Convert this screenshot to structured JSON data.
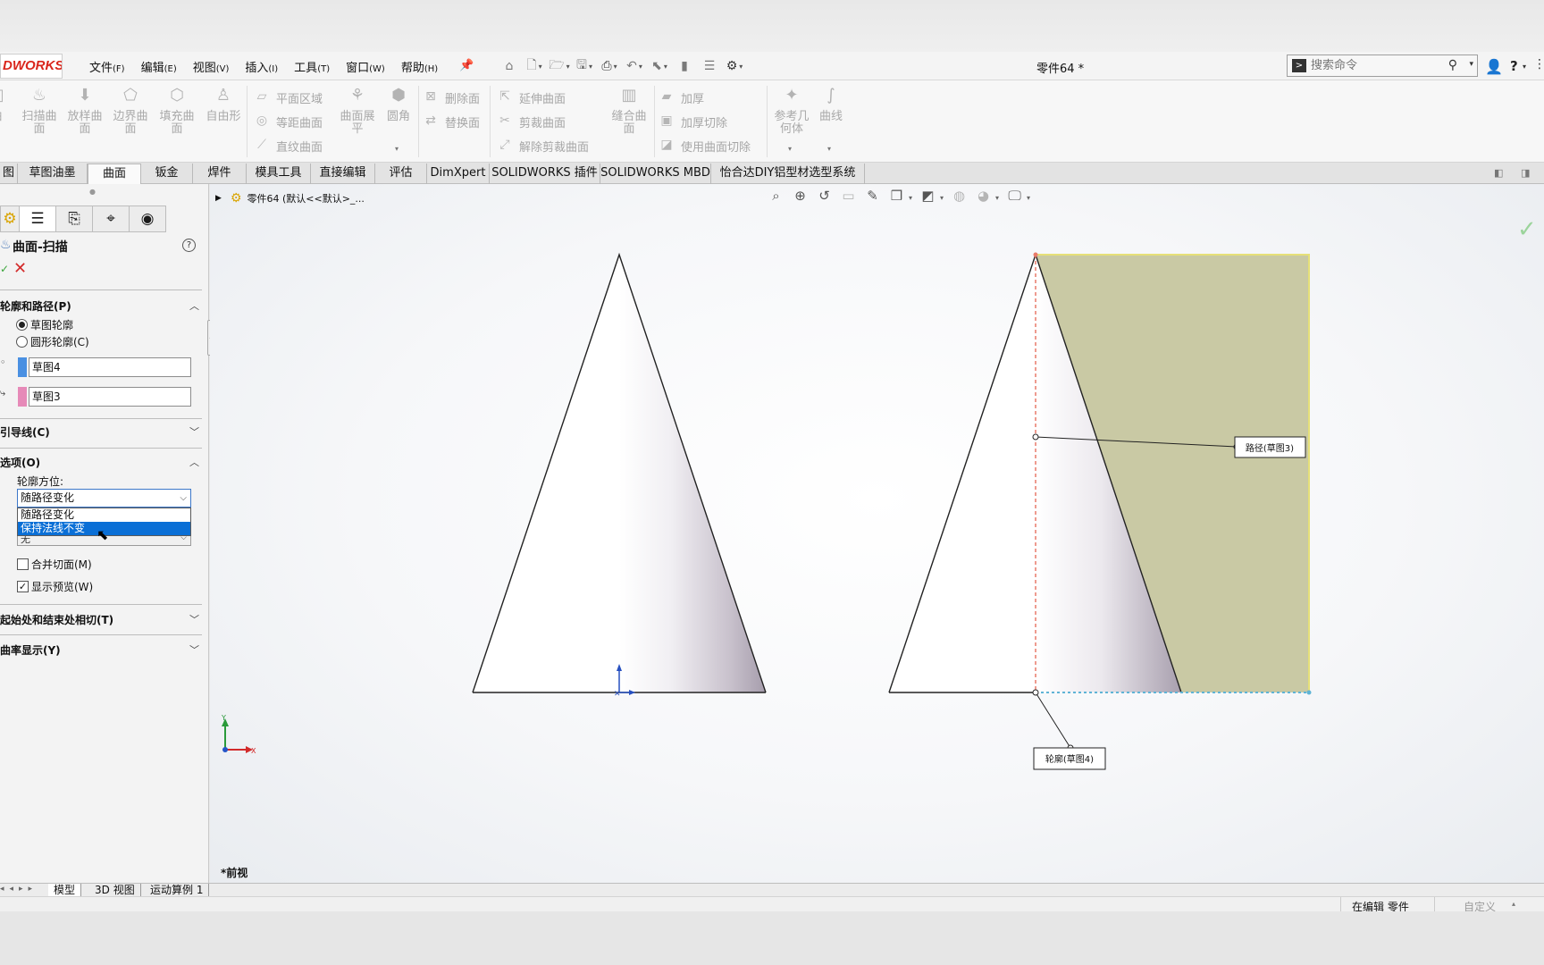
{
  "app": {
    "logo_text": "DWORKS",
    "document_title": "零件64 *"
  },
  "menu": {
    "items": [
      {
        "label": "文件",
        "hotkey": "(F)"
      },
      {
        "label": "编辑",
        "hotkey": "(E)"
      },
      {
        "label": "视图",
        "hotkey": "(V)"
      },
      {
        "label": "插入",
        "hotkey": "(I)"
      },
      {
        "label": "工具",
        "hotkey": "(T)"
      },
      {
        "label": "窗口",
        "hotkey": "(W)"
      },
      {
        "label": "帮助",
        "hotkey": "(H)"
      }
    ]
  },
  "search": {
    "placeholder": "搜索命令"
  },
  "ribbon": {
    "large_buttons": [
      "曲",
      "扫描曲面",
      "放样曲面",
      "边界曲面",
      "填充曲面",
      "自由形",
      "曲面展平",
      "圆角",
      "缝合曲面",
      "参考几何体",
      "曲线"
    ],
    "group1_small": [
      "平面区域",
      "等距曲面",
      "直纹曲面"
    ],
    "group2_small": [
      "删除面",
      "替换面"
    ],
    "group3_small": [
      "延伸曲面",
      "剪裁曲面",
      "解除剪裁曲面"
    ],
    "group4_small": [
      "加厚",
      "加厚切除",
      "使用曲面切除"
    ]
  },
  "tabs": {
    "items": [
      "图",
      "草图油墨",
      "曲面",
      "钣金",
      "焊件",
      "模具工具",
      "直接编辑",
      "评估",
      "DimXpert",
      "SOLIDWORKS 插件",
      "SOLIDWORKS MBD",
      "怡合达DIY铝型材选型系统"
    ],
    "active_index": 2
  },
  "property_manager": {
    "title": "曲面-扫描",
    "section_profile_path": "轮廓和路径(P)",
    "radio_sketch_profile": "草图轮廓",
    "radio_circular_profile": "圆形轮廓(C)",
    "profile_value": "草图4",
    "path_value": "草图3",
    "profile_color": "#4a90e2",
    "path_color": "#e68ab8",
    "section_guides": "引导线(C)",
    "section_options": "选项(O)",
    "orientation_label": "轮廓方位:",
    "orientation_value": "随路径变化",
    "orientation_options": [
      "随路径变化",
      "保持法线不变"
    ],
    "highlighted_option_index": 1,
    "twist_value": "无",
    "merge_faces": "合并切面(M)",
    "show_preview": "显示预览(W)",
    "show_preview_checked": true,
    "section_tangency": "起始处和结束处相切(T)",
    "section_curvature": "曲率显示(Y)"
  },
  "viewport": {
    "breadcrumb": "零件64 (默认<<默认>_...",
    "view_label": "*前视",
    "callout_path": "路径(草图3)",
    "callout_profile": "轮廓(草图4)",
    "axis_x": "X",
    "axis_y": "Y"
  },
  "bottom_tabs": [
    "模型",
    "3D 视图",
    "运动算例 1"
  ],
  "status": {
    "editing": "在编辑 零件",
    "units": "自定义"
  }
}
